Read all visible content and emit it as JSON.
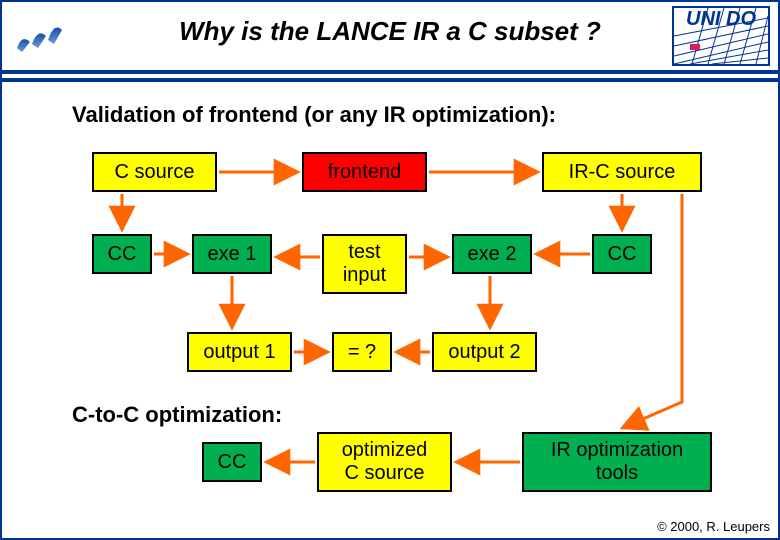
{
  "title": "Why is the LANCE IR a C subset ?",
  "corner_label": "UNI DO",
  "section1": "Validation of frontend (or any IR optimization):",
  "section2": "C-to-C optimization:",
  "boxes": {
    "c_source": "C source",
    "frontend": "frontend",
    "ir_c_source": "IR-C source",
    "cc_left": "CC",
    "exe1": "exe 1",
    "test_input": "test\ninput",
    "exe2": "exe 2",
    "cc_right": "CC",
    "output1": "output 1",
    "eq": "= ?",
    "output2": "output 2",
    "cc_bottom": "CC",
    "opt_c_source": "optimized\nC source",
    "ir_tools": "IR optimization\ntools"
  },
  "footer": "© 2000, R. Leupers"
}
